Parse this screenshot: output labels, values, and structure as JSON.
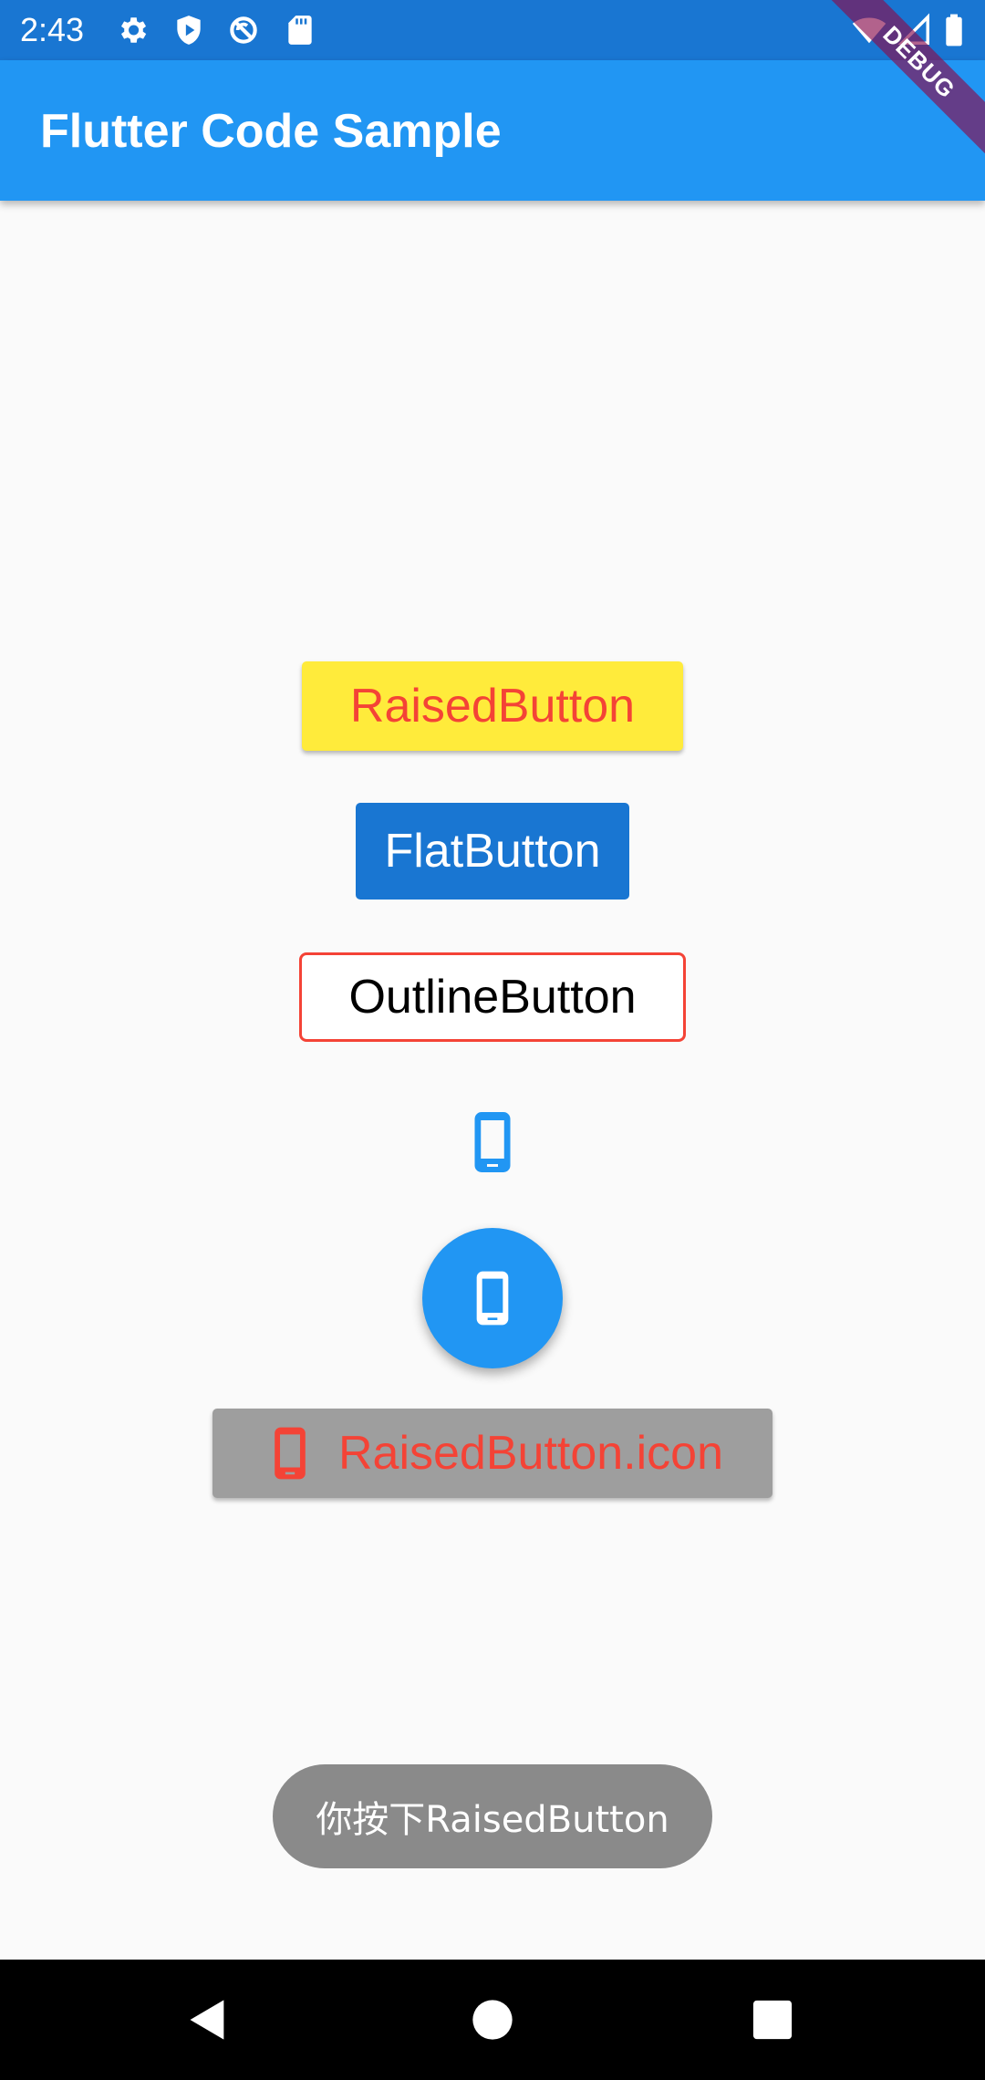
{
  "status_bar": {
    "time": "2:43",
    "icons": [
      "settings-icon",
      "shield-icon",
      "no-sync-icon",
      "sd-card-icon",
      "wifi-icon",
      "signal-icon",
      "battery-icon"
    ]
  },
  "app_bar": {
    "title": "Flutter Code Sample"
  },
  "debug_banner": {
    "label": "DEBUG"
  },
  "buttons": {
    "raised": "RaisedButton",
    "flat": "FlatButton",
    "outline": "OutlineButton",
    "icon_button_icon": "phone-android-icon",
    "fab_icon": "phone-android-icon",
    "raised_icon": "RaisedButton.icon"
  },
  "toast": {
    "message": "你按下RaisedButton"
  },
  "nav_bar": {
    "icons": [
      "back-icon",
      "home-icon",
      "recents-icon"
    ]
  },
  "colors": {
    "status_bar": "#1976D2",
    "app_bar": "#2196F3",
    "raised_bg": "#FFEB3B",
    "raised_text": "#F44336",
    "flat_bg": "#1976D2",
    "outline_border": "#F44336",
    "raised_icon_bg": "#9E9E9E",
    "toast_bg": "#8A8A8A",
    "debug_ribbon": "#880E4F"
  }
}
